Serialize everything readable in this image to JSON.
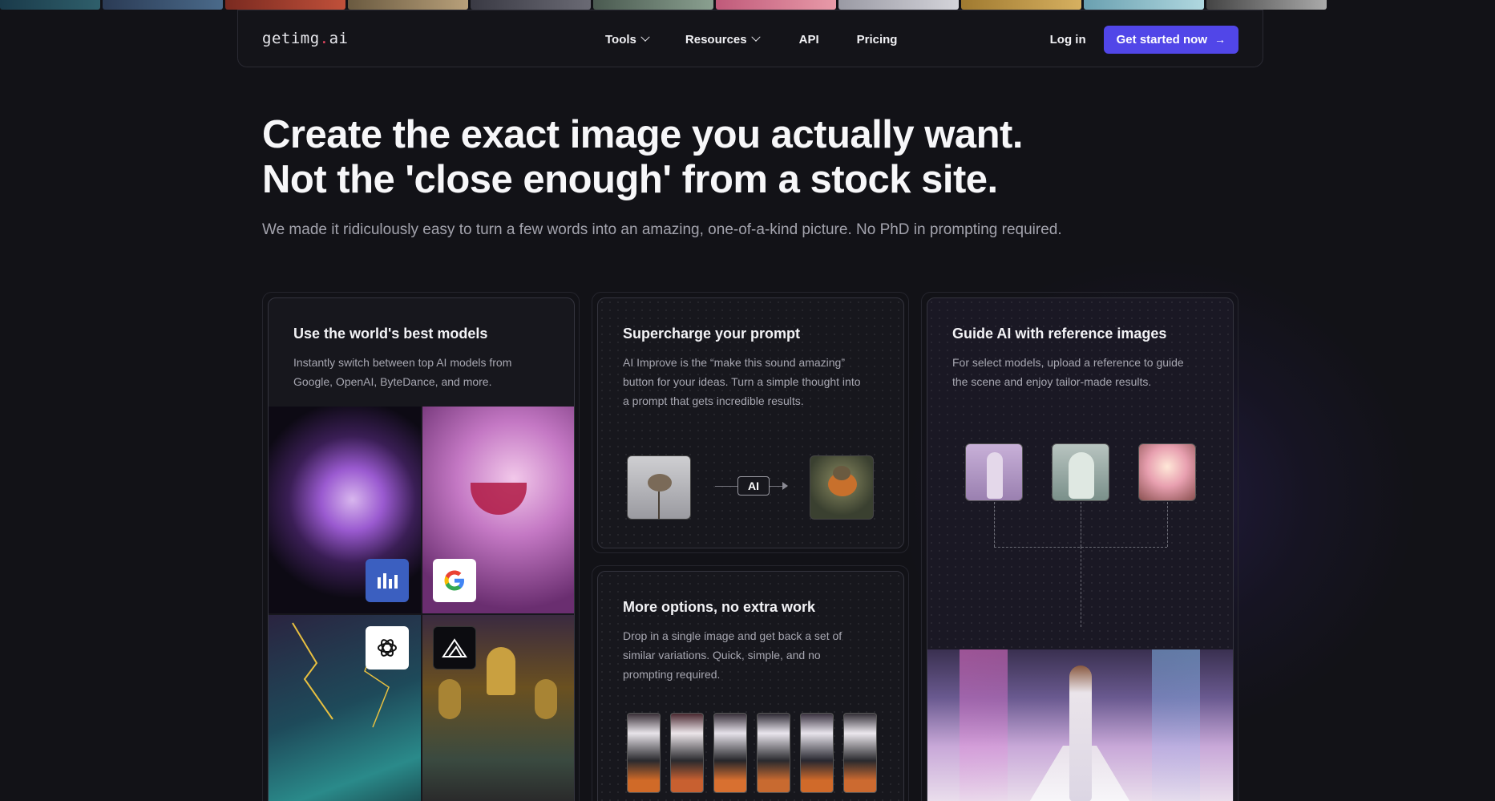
{
  "nav": {
    "logo_main": "getimg",
    "logo_dot": ".",
    "logo_tld": "ai",
    "items": [
      {
        "label": "Tools",
        "has_menu": true
      },
      {
        "label": "Resources",
        "has_menu": true
      },
      {
        "label": "API",
        "has_menu": false
      },
      {
        "label": "Pricing",
        "has_menu": false
      }
    ],
    "login": "Log in",
    "cta": "Get started now",
    "accent": "#5146e8"
  },
  "hero": {
    "line1": "Create the exact image you actually want.",
    "line2": "Not the 'close enough' from a stock site.",
    "subtitle": "We made it ridiculously easy to turn a few words into an amazing, one-of-a-kind picture. No PhD in prompting required."
  },
  "cards": {
    "models": {
      "title": "Use the world's best models",
      "desc_line1": "Instantly switch between top AI models from",
      "desc_line2": "Google, OpenAI, ByteDance, and more.",
      "logos": [
        "bytedance-icon",
        "google-icon",
        "openai-icon",
        "blackforest-icon"
      ]
    },
    "prompt": {
      "title": "Supercharge your prompt",
      "desc_line1": "AI Improve is the “make this sound amazing”",
      "desc_line2": "button for your ideas. Turn a simple thought into",
      "desc_line3": "a prompt that gets incredible results.",
      "ai_label": "AI"
    },
    "options": {
      "title": "More options, no extra work",
      "desc_line1": "Drop in a single image and get back a set of",
      "desc_line2": "similar variations. Quick, simple, and no",
      "desc_line3": "prompting required."
    },
    "reference": {
      "title": "Guide AI with reference images",
      "desc_line1": "For select models, upload a reference to guide",
      "desc_line2": "the scene and enjoy tailor-made results."
    }
  }
}
